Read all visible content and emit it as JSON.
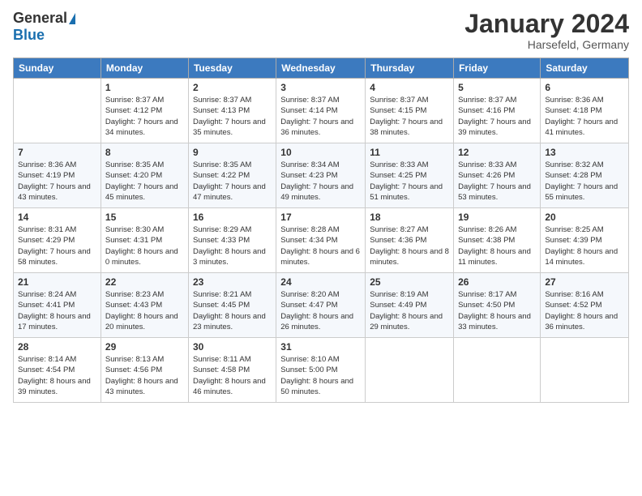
{
  "header": {
    "logo_general": "General",
    "logo_blue": "Blue",
    "title": "January 2024",
    "location": "Harsefeld, Germany"
  },
  "days_of_week": [
    "Sunday",
    "Monday",
    "Tuesday",
    "Wednesday",
    "Thursday",
    "Friday",
    "Saturday"
  ],
  "weeks": [
    [
      null,
      {
        "day": 1,
        "sunrise": "8:37 AM",
        "sunset": "4:12 PM",
        "daylight": "7 hours and 34 minutes."
      },
      {
        "day": 2,
        "sunrise": "8:37 AM",
        "sunset": "4:13 PM",
        "daylight": "7 hours and 35 minutes."
      },
      {
        "day": 3,
        "sunrise": "8:37 AM",
        "sunset": "4:14 PM",
        "daylight": "7 hours and 36 minutes."
      },
      {
        "day": 4,
        "sunrise": "8:37 AM",
        "sunset": "4:15 PM",
        "daylight": "7 hours and 38 minutes."
      },
      {
        "day": 5,
        "sunrise": "8:37 AM",
        "sunset": "4:16 PM",
        "daylight": "7 hours and 39 minutes."
      },
      {
        "day": 6,
        "sunrise": "8:36 AM",
        "sunset": "4:18 PM",
        "daylight": "7 hours and 41 minutes."
      }
    ],
    [
      {
        "day": 7,
        "sunrise": "8:36 AM",
        "sunset": "4:19 PM",
        "daylight": "7 hours and 43 minutes."
      },
      {
        "day": 8,
        "sunrise": "8:35 AM",
        "sunset": "4:20 PM",
        "daylight": "7 hours and 45 minutes."
      },
      {
        "day": 9,
        "sunrise": "8:35 AM",
        "sunset": "4:22 PM",
        "daylight": "7 hours and 47 minutes."
      },
      {
        "day": 10,
        "sunrise": "8:34 AM",
        "sunset": "4:23 PM",
        "daylight": "7 hours and 49 minutes."
      },
      {
        "day": 11,
        "sunrise": "8:33 AM",
        "sunset": "4:25 PM",
        "daylight": "7 hours and 51 minutes."
      },
      {
        "day": 12,
        "sunrise": "8:33 AM",
        "sunset": "4:26 PM",
        "daylight": "7 hours and 53 minutes."
      },
      {
        "day": 13,
        "sunrise": "8:32 AM",
        "sunset": "4:28 PM",
        "daylight": "7 hours and 55 minutes."
      }
    ],
    [
      {
        "day": 14,
        "sunrise": "8:31 AM",
        "sunset": "4:29 PM",
        "daylight": "7 hours and 58 minutes."
      },
      {
        "day": 15,
        "sunrise": "8:30 AM",
        "sunset": "4:31 PM",
        "daylight": "8 hours and 0 minutes."
      },
      {
        "day": 16,
        "sunrise": "8:29 AM",
        "sunset": "4:33 PM",
        "daylight": "8 hours and 3 minutes."
      },
      {
        "day": 17,
        "sunrise": "8:28 AM",
        "sunset": "4:34 PM",
        "daylight": "8 hours and 6 minutes."
      },
      {
        "day": 18,
        "sunrise": "8:27 AM",
        "sunset": "4:36 PM",
        "daylight": "8 hours and 8 minutes."
      },
      {
        "day": 19,
        "sunrise": "8:26 AM",
        "sunset": "4:38 PM",
        "daylight": "8 hours and 11 minutes."
      },
      {
        "day": 20,
        "sunrise": "8:25 AM",
        "sunset": "4:39 PM",
        "daylight": "8 hours and 14 minutes."
      }
    ],
    [
      {
        "day": 21,
        "sunrise": "8:24 AM",
        "sunset": "4:41 PM",
        "daylight": "8 hours and 17 minutes."
      },
      {
        "day": 22,
        "sunrise": "8:23 AM",
        "sunset": "4:43 PM",
        "daylight": "8 hours and 20 minutes."
      },
      {
        "day": 23,
        "sunrise": "8:21 AM",
        "sunset": "4:45 PM",
        "daylight": "8 hours and 23 minutes."
      },
      {
        "day": 24,
        "sunrise": "8:20 AM",
        "sunset": "4:47 PM",
        "daylight": "8 hours and 26 minutes."
      },
      {
        "day": 25,
        "sunrise": "8:19 AM",
        "sunset": "4:49 PM",
        "daylight": "8 hours and 29 minutes."
      },
      {
        "day": 26,
        "sunrise": "8:17 AM",
        "sunset": "4:50 PM",
        "daylight": "8 hours and 33 minutes."
      },
      {
        "day": 27,
        "sunrise": "8:16 AM",
        "sunset": "4:52 PM",
        "daylight": "8 hours and 36 minutes."
      }
    ],
    [
      {
        "day": 28,
        "sunrise": "8:14 AM",
        "sunset": "4:54 PM",
        "daylight": "8 hours and 39 minutes."
      },
      {
        "day": 29,
        "sunrise": "8:13 AM",
        "sunset": "4:56 PM",
        "daylight": "8 hours and 43 minutes."
      },
      {
        "day": 30,
        "sunrise": "8:11 AM",
        "sunset": "4:58 PM",
        "daylight": "8 hours and 46 minutes."
      },
      {
        "day": 31,
        "sunrise": "8:10 AM",
        "sunset": "5:00 PM",
        "daylight": "8 hours and 50 minutes."
      },
      null,
      null,
      null
    ]
  ]
}
